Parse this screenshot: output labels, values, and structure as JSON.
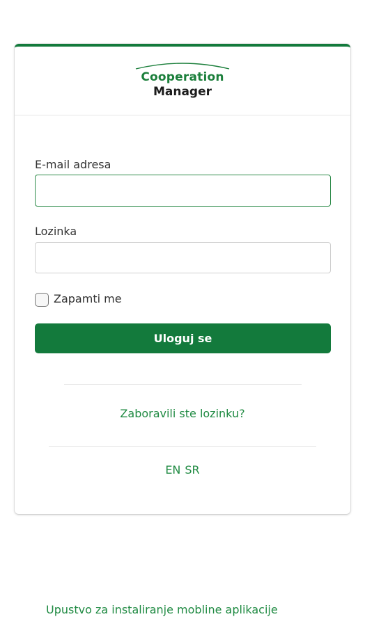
{
  "logo": {
    "line1": "Cooperation",
    "line2": "Manager"
  },
  "form": {
    "email_label": "E-mail adresa",
    "email_value": "",
    "password_label": "Lozinka",
    "password_value": "",
    "remember_label": "Zapamti me",
    "remember_checked": false,
    "login_button": "Uloguj se"
  },
  "links": {
    "forgot_password": "Zaboravili ste lozinku?",
    "lang_en": "EN",
    "lang_sr": "SR",
    "install_app": "Upustvo za instaliranje mobline aplikacije"
  },
  "colors": {
    "brand_green": "#137a3c",
    "link_green": "#1f8a42",
    "text_dark": "#333333"
  }
}
